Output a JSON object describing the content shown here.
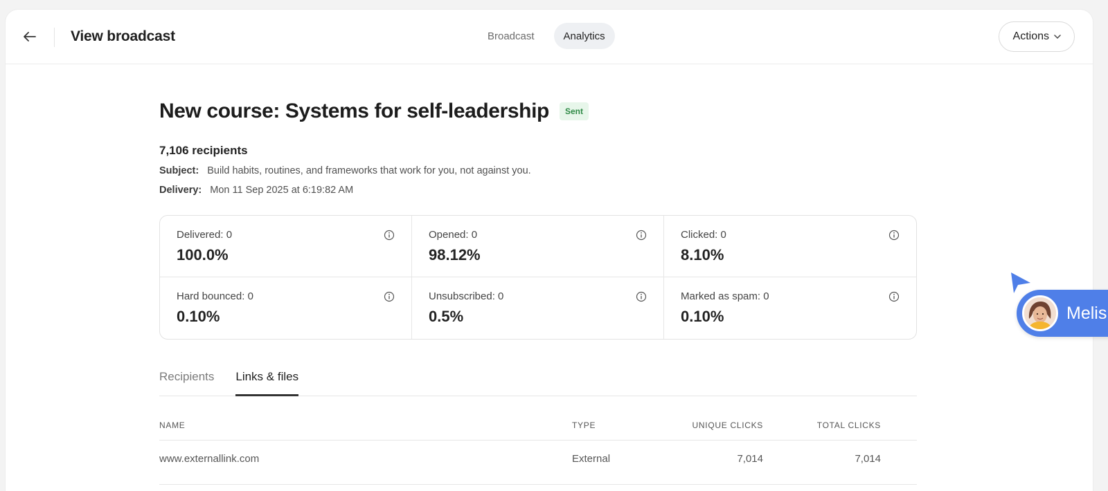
{
  "header": {
    "title": "View broadcast",
    "tabs": [
      {
        "label": "Broadcast",
        "active": false
      },
      {
        "label": "Analytics",
        "active": true
      }
    ],
    "actions_label": "Actions"
  },
  "broadcast": {
    "title": "New course: Systems for self-leadership",
    "status": "Sent",
    "recipients": "7,106 recipients",
    "subject_label": "Subject:",
    "subject": "Build habits, routines, and frameworks that work for you, not against you.",
    "delivery_label": "Delivery:",
    "delivery": "Mon 11 Sep 2025 at 6:19:82 AM"
  },
  "stats": [
    {
      "label": "Delivered: 0",
      "value": "100.0%"
    },
    {
      "label": "Opened: 0",
      "value": "98.12%"
    },
    {
      "label": "Clicked: 0",
      "value": "8.10%"
    },
    {
      "label": "Hard bounced: 0",
      "value": "0.10%"
    },
    {
      "label": "Unsubscribed: 0",
      "value": "0.5%"
    },
    {
      "label": "Marked as spam: 0",
      "value": "0.10%"
    }
  ],
  "sub_tabs": [
    {
      "label": "Recipients",
      "active": false
    },
    {
      "label": "Links & files",
      "active": true
    }
  ],
  "table": {
    "columns": [
      "NAME",
      "TYPE",
      "UNIQUE CLICKS",
      "TOTAL CLICKS"
    ],
    "rows": [
      {
        "name": "www.externallink.com",
        "type": "External",
        "unique": "7,014",
        "total": "7,014"
      }
    ]
  },
  "presence": {
    "name": "Melis"
  },
  "colors": {
    "accent": "#4f7fe8",
    "sent_bg": "#e7f6ea",
    "sent_text": "#2f8a46"
  }
}
